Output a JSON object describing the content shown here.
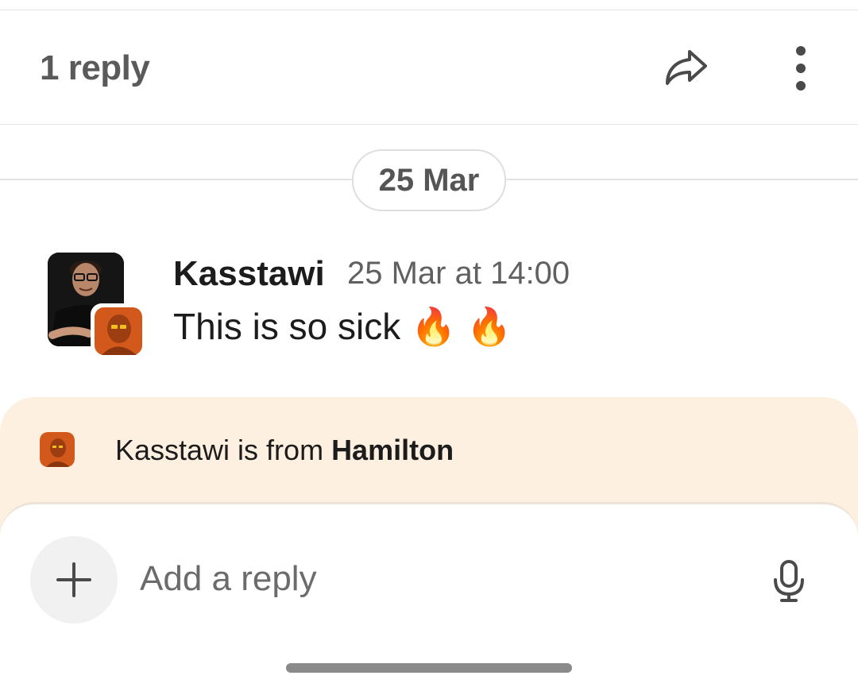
{
  "header": {
    "title": "1 reply",
    "share_icon": "share-forward-icon",
    "more_icon": "more-vertical-icon"
  },
  "date_divider": {
    "label": "25 Mar"
  },
  "message": {
    "sender": "Kasstawi",
    "timestamp": "25 Mar at 14:00",
    "text": "This is so sick 🔥 🔥"
  },
  "banner": {
    "prefix": "Kasstawi is from ",
    "org": "Hamilton"
  },
  "composer": {
    "placeholder": "Add a reply",
    "add_icon": "plus-icon",
    "mic_icon": "microphone-icon"
  },
  "colors": {
    "banner_bg": "#fdf0e0",
    "text_primary": "#1d1c1d",
    "text_muted": "#616061",
    "badge_orange": "#d2591b"
  }
}
